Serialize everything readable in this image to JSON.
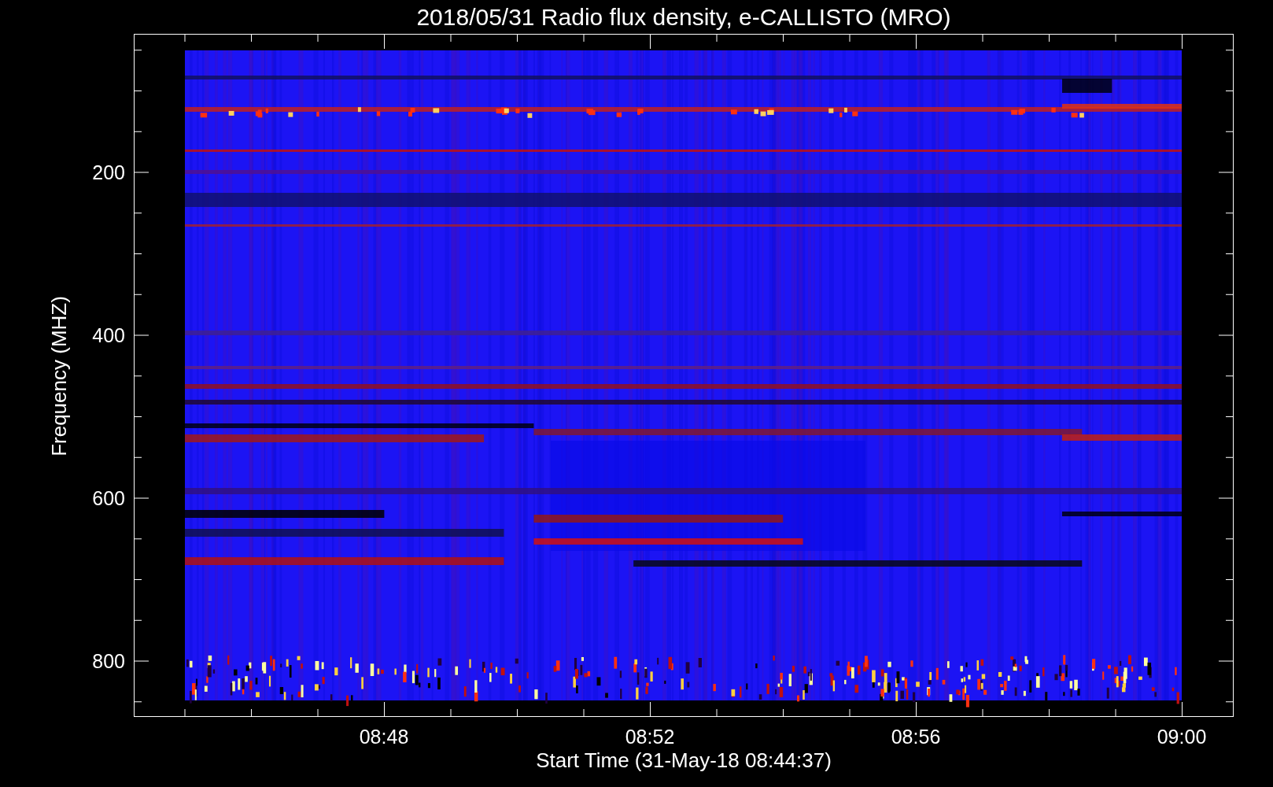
{
  "title": "2018/05/31  Radio flux density, e-CALLISTO (MRO)",
  "y_axis": {
    "label": "Frequency (MHZ)",
    "ticks": [
      "200",
      "400",
      "600",
      "800"
    ]
  },
  "x_axis": {
    "label": "Start Time (31-May-18 08:44:37)",
    "ticks": [
      "08:48",
      "08:52",
      "08:56",
      "09:00"
    ]
  }
}
